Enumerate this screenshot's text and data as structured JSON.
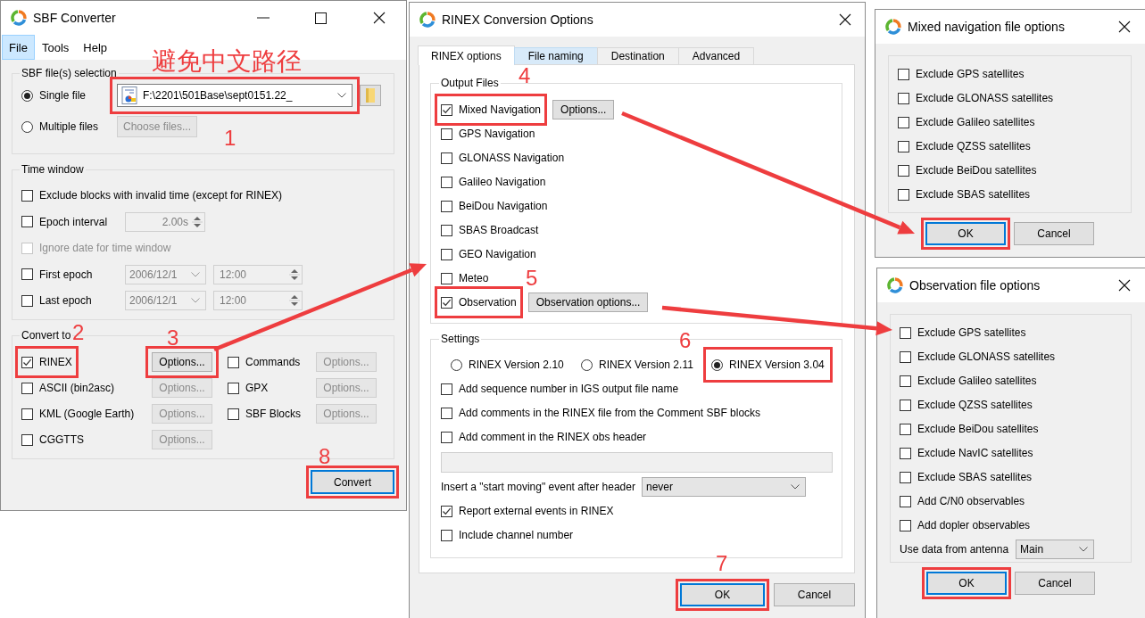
{
  "converter": {
    "title": "SBF Converter",
    "menu": [
      {
        "label": "File",
        "selected": true
      },
      {
        "label": "Tools",
        "selected": false
      },
      {
        "label": "Help",
        "selected": false
      }
    ],
    "file_selection": {
      "title": "SBF file(s) selection",
      "modes": [
        {
          "label": "Single file",
          "selected": true
        },
        {
          "label": "Multiple files",
          "selected": false
        }
      ],
      "file_path": "F:\\2201\\501Base\\sept0151.22_",
      "file_highlighted": true,
      "choose_files": {
        "label": "Choose files...",
        "disabled": true
      }
    },
    "time_window": {
      "title": "Time window",
      "rows": [
        {
          "kind": "check",
          "label": "Exclude blocks with invalid time (except for RINEX)",
          "checked": false,
          "disabled": false
        },
        {
          "kind": "interval",
          "label": "Epoch interval",
          "checked": false,
          "disabled": false,
          "value": "2.00s"
        },
        {
          "kind": "check",
          "label": "Ignore date for time window",
          "checked": false,
          "disabled": true
        },
        {
          "kind": "datetime",
          "label": "First epoch",
          "checked": false,
          "disabled": false,
          "date": "2006/12/1",
          "time": "12:00"
        },
        {
          "kind": "datetime",
          "label": "Last epoch",
          "checked": false,
          "disabled": false,
          "date": "2006/12/1",
          "time": "12:00"
        }
      ]
    },
    "convert_to": {
      "title": "Convert to",
      "formats": [
        {
          "label": "RINEX",
          "checked": true,
          "highlighted": true,
          "options": "Options...",
          "options_disabled": false,
          "options_highlighted": true
        },
        {
          "label": "Commands",
          "checked": false,
          "highlighted": false,
          "options": "Options...",
          "options_disabled": true,
          "options_highlighted": false
        },
        {
          "label": "ASCII (bin2asc)",
          "checked": false,
          "highlighted": false,
          "options": "Options...",
          "options_disabled": true,
          "options_highlighted": false
        },
        {
          "label": "GPX",
          "checked": false,
          "highlighted": false,
          "options": "Options...",
          "options_disabled": true,
          "options_highlighted": false
        },
        {
          "label": "KML (Google Earth)",
          "checked": false,
          "highlighted": false,
          "options": "Options...",
          "options_disabled": true,
          "options_highlighted": false
        },
        {
          "label": "SBF Blocks",
          "checked": false,
          "highlighted": false,
          "options": "Options...",
          "options_disabled": true,
          "options_highlighted": false
        },
        {
          "label": "CGGTTS",
          "checked": false,
          "highlighted": false,
          "options": "Options...",
          "options_disabled": true,
          "options_highlighted": false
        }
      ]
    },
    "convert_button": {
      "label": "Convert",
      "default": true,
      "highlighted": true
    }
  },
  "rinex": {
    "title": "RINEX Conversion Options",
    "tabs": [
      {
        "label": "RINEX options",
        "selected": true,
        "hovered": false
      },
      {
        "label": "File naming",
        "selected": false,
        "hovered": true
      },
      {
        "label": "Destination",
        "selected": false,
        "hovered": false
      },
      {
        "label": "Advanced",
        "selected": false,
        "hovered": false
      }
    ],
    "output_files": {
      "title": "Output Files",
      "items": [
        {
          "kind": "with_button",
          "label": "Mixed Navigation",
          "checked": true,
          "highlighted": true,
          "button": "Options..."
        },
        {
          "kind": "plain",
          "label": "GPS Navigation",
          "checked": false,
          "highlighted": false
        },
        {
          "kind": "plain",
          "label": "GLONASS Navigation",
          "checked": false,
          "highlighted": false
        },
        {
          "kind": "plain",
          "label": "Galileo Navigation",
          "checked": false,
          "highlighted": false
        },
        {
          "kind": "plain",
          "label": "BeiDou Navigation",
          "checked": false,
          "highlighted": false
        },
        {
          "kind": "plain",
          "label": "SBAS Broadcast",
          "checked": false,
          "highlighted": false
        },
        {
          "kind": "plain",
          "label": "GEO Navigation",
          "checked": false,
          "highlighted": false
        },
        {
          "kind": "plain",
          "label": "Meteo",
          "checked": false,
          "highlighted": false
        },
        {
          "kind": "with_button",
          "label": "Observation",
          "checked": true,
          "highlighted": true,
          "button": "Observation options..."
        }
      ]
    },
    "settings": {
      "title": "Settings",
      "versions": [
        {
          "label": "RINEX Version 2.10",
          "selected": false,
          "highlighted": false
        },
        {
          "label": "RINEX Version 2.11",
          "selected": false,
          "highlighted": false
        },
        {
          "label": "RINEX Version 3.04",
          "selected": true,
          "highlighted": true
        }
      ],
      "checks": [
        {
          "label": "Add sequence number in IGS output file name",
          "checked": false
        },
        {
          "label": "Add comments in the RINEX file from the Comment SBF blocks",
          "checked": false
        },
        {
          "label": "Add comment in the RINEX obs header",
          "checked": false
        }
      ],
      "event": {
        "label": "Insert a \"start moving\" event after header",
        "value": "never"
      },
      "more_checks": [
        {
          "label": "Report external events in RINEX",
          "checked": true
        },
        {
          "label": "Include channel number",
          "checked": false
        }
      ]
    },
    "buttons": [
      {
        "label": "OK",
        "default": true,
        "highlighted": true
      },
      {
        "label": "Cancel",
        "default": false,
        "highlighted": false
      }
    ]
  },
  "mixed_nav": {
    "title": "Mixed navigation file options",
    "options": [
      {
        "label": "Exclude GPS satellites",
        "checked": false
      },
      {
        "label": "Exclude GLONASS satellites",
        "checked": false
      },
      {
        "label": "Exclude Galileo satellites",
        "checked": false
      },
      {
        "label": "Exclude QZSS satellites",
        "checked": false
      },
      {
        "label": "Exclude BeiDou satellites",
        "checked": false
      },
      {
        "label": "Exclude SBAS satellites",
        "checked": false
      }
    ],
    "buttons": [
      {
        "label": "OK",
        "default": true,
        "highlighted": true
      },
      {
        "label": "Cancel",
        "default": false,
        "highlighted": false
      }
    ]
  },
  "observation": {
    "title": "Observation file options",
    "options": [
      {
        "label": "Exclude GPS satellites",
        "checked": false
      },
      {
        "label": "Exclude GLONASS satellites",
        "checked": false
      },
      {
        "label": "Exclude Galileo satellites",
        "checked": false
      },
      {
        "label": "Exclude QZSS satellites",
        "checked": false
      },
      {
        "label": "Exclude BeiDou satellites",
        "checked": false
      },
      {
        "label": "Exclude NavIC satellites",
        "checked": false
      },
      {
        "label": "Exclude SBAS satellites",
        "checked": false
      },
      {
        "label": "Add C/N0 observables",
        "checked": false
      },
      {
        "label": "Add dopler observables",
        "checked": false
      }
    ],
    "antenna": {
      "label": "Use data from antenna",
      "value": "Main"
    },
    "buttons": [
      {
        "label": "OK",
        "default": true,
        "highlighted": true
      },
      {
        "label": "Cancel",
        "default": false,
        "highlighted": false
      }
    ]
  },
  "annotations": [
    {
      "label": "避免中文路径"
    },
    {
      "label": "1"
    },
    {
      "label": "2"
    },
    {
      "label": "3"
    },
    {
      "label": "4"
    },
    {
      "label": "5"
    },
    {
      "label": "6"
    },
    {
      "label": "7"
    },
    {
      "label": "8"
    }
  ]
}
